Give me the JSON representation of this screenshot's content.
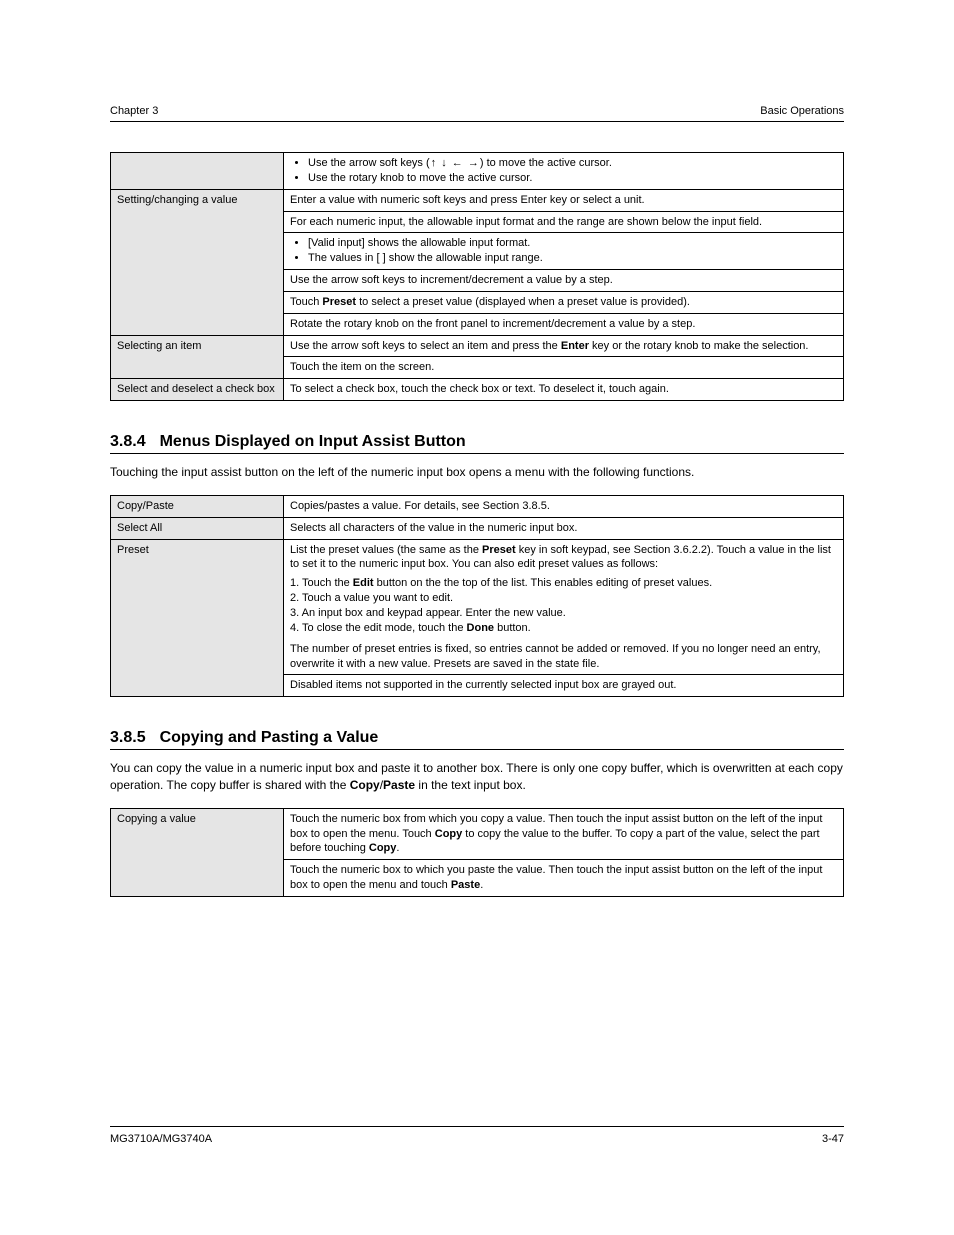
{
  "header": {
    "left": "Chapter 3",
    "right": "Basic Operations"
  },
  "table1": {
    "rows": [
      {
        "label": "",
        "bullets": [
          {
            "parts": [
              {
                "t": "Use the arrow soft keys ("
              },
              {
                "t": "↑",
                "arrow": true
              },
              {
                "t": " "
              },
              {
                "t": "↓",
                "arrow": true
              },
              {
                "t": " "
              },
              {
                "t": "←",
                "arrow": true
              },
              {
                "t": " "
              },
              {
                "t": "→",
                "arrow": true
              },
              {
                "t": ") to move the active cursor."
              }
            ]
          },
          {
            "parts": [
              {
                "t": "Use the rotary knob to move the active cursor."
              }
            ]
          }
        ]
      },
      {
        "label": "Setting/changing a value",
        "children": [
          {
            "text": "Enter a value with numeric soft keys and press Enter key or select a unit."
          },
          {
            "text": "For each numeric input, the allowable input format and the range are shown below the input field."
          },
          {
            "bullets": [
              {
                "parts": [
                  {
                    "t": "[Valid input] shows the allowable input format."
                  }
                ]
              },
              {
                "parts": [
                  {
                    "t": "The values in [ ] show the allowable input range."
                  }
                ]
              }
            ]
          },
          {
            "text": "Use the arrow soft keys to increment/decrement a value by a step."
          },
          {
            "parts": [
              {
                "t": "Touch "
              },
              {
                "t": "Preset",
                "bold": true
              },
              {
                "t": " to select a preset value (displayed when a preset value is provided)."
              }
            ]
          },
          {
            "text": "Rotate the rotary knob on the front panel to increment/decrement a value by a step."
          }
        ]
      },
      {
        "label": "Selecting an item",
        "children": [
          {
            "parts": [
              {
                "t": "Use the arrow soft keys to select an item and press the "
              },
              {
                "t": "Enter",
                "bold": true
              },
              {
                "t": " key or the rotary knob to make the selection."
              }
            ]
          },
          {
            "text": "Touch the item on the screen."
          }
        ]
      },
      {
        "label": "Select and deselect a check box",
        "text": "To select a check box, touch the check box or text. To deselect it, touch again."
      }
    ]
  },
  "section2": {
    "number": "3.8.4",
    "title": "Menus Displayed on Input Assist Button",
    "desc": "Touching the input assist button on the left of the numeric input box opens a menu with the following functions."
  },
  "table2": {
    "rows": [
      {
        "label": "Copy/Paste",
        "text": "Copies/pastes a value. For details, see Section 3.8.5."
      },
      {
        "label": "Select All",
        "text": "Selects all characters of the value in the numeric input box."
      },
      {
        "label": "Preset",
        "parts": [
          {
            "t": "List the preset values (the same as the "
          },
          {
            "t": "Preset",
            "bold": true
          },
          {
            "t": " key in soft keypad, see Section 3.6.2.2). Touch a value in the list to set it to the numeric input box. You can also edit preset values as follows:\n"
          }
        ],
        "steps": [
          {
            "parts": [
              {
                "t": "Touch the "
              },
              {
                "t": "Edit",
                "bold": true
              },
              {
                "t": " button on the the top of the list. This enables editing of preset values."
              }
            ]
          },
          {
            "parts": [
              {
                "t": "Touch a value you want to edit."
              }
            ]
          },
          {
            "parts": [
              {
                "t": "An input box and keypad appear. Enter the new value."
              }
            ]
          },
          {
            "parts": [
              {
                "t": "To close the edit mode, touch the "
              },
              {
                "t": "Done",
                "bold": true
              },
              {
                "t": " button."
              }
            ]
          }
        ],
        "note": "The number of preset entries is fixed, so entries cannot be added or removed. If you no longer need an entry, overwrite it with a new value. Presets are saved in the state file."
      },
      {
        "label": "",
        "text": "Disabled items not supported in the currently selected input box are grayed out."
      }
    ]
  },
  "section3": {
    "number": "3.8.5",
    "title": "Copying and Pasting a Value",
    "desc_parts": [
      {
        "t": "You can copy the value in a numeric input box and paste it to another box. There is only one copy buffer, which is overwritten at each copy operation. The copy buffer is shared with the "
      },
      {
        "t": "Copy",
        "bold": true
      },
      {
        "t": "/"
      },
      {
        "t": "Paste",
        "bold": true
      },
      {
        "t": " in the text input box."
      }
    ]
  },
  "table3": {
    "rows": [
      {
        "label": "Copying a value",
        "parts": [
          {
            "t": "Touch the numeric box from which you copy a value. Then touch the input assist button on the left of the input box to open the menu. Touch "
          },
          {
            "t": "Copy",
            "bold": true
          },
          {
            "t": " to copy the value to the buffer. To copy a part of the value, select the part before touching "
          },
          {
            "t": "Copy",
            "bold": true
          },
          {
            "t": "."
          }
        ]
      },
      {
        "label": "",
        "parts": [
          {
            "t": "Touch the numeric box to which you paste the value. Then touch the input assist button on the left of the input box to open the menu and touch "
          },
          {
            "t": "Paste",
            "bold": true
          },
          {
            "t": "."
          }
        ]
      }
    ]
  },
  "footer": {
    "left": "MG3710A/MG3740A",
    "right": "3-47"
  }
}
